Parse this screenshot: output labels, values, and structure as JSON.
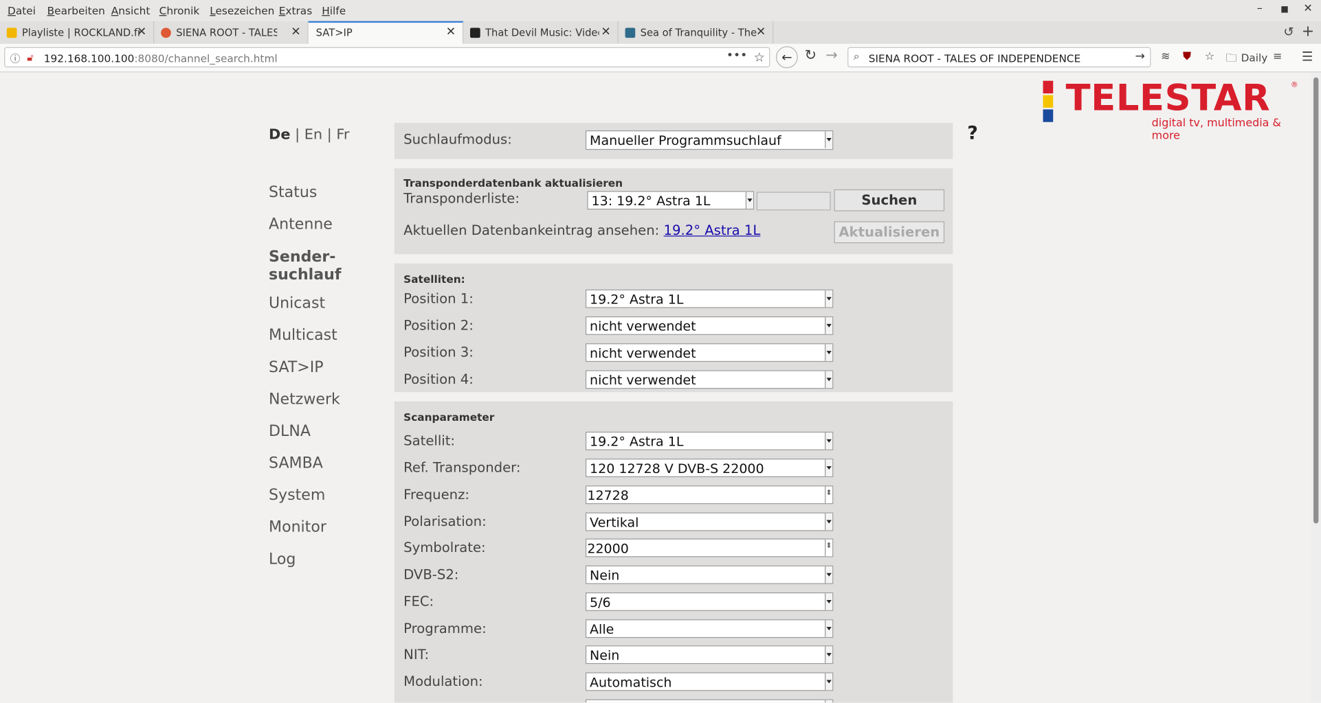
{
  "menubar": {
    "items": [
      "Datei",
      "Bearbeiten",
      "Ansicht",
      "Chronik",
      "Lesezeichen",
      "Extras",
      "Hilfe"
    ]
  },
  "tabs": [
    {
      "title": "Playliste | ROCKLAND.fm",
      "favicon_color": "#f2b705"
    },
    {
      "title": "SIENA ROOT - TALES OF",
      "favicon_color": "#de5833"
    },
    {
      "title": "SAT>IP",
      "favicon_color": ""
    },
    {
      "title": "That Devil Music: Video of",
      "favicon_color": "#222222"
    },
    {
      "title": "Sea of Tranquility - The W",
      "favicon_color": "#2f6b8a"
    }
  ],
  "address": {
    "host": "192.168.100.100",
    "rest": ":8080/channel_search.html"
  },
  "search": {
    "query": "SIENA ROOT - TALES OF INDEPENDENCE"
  },
  "toolbar": {
    "bookmark_folder": "Daily"
  },
  "brand": {
    "name": "TELESTAR",
    "reg": "®",
    "tagline": "digital tv, multimedia & more",
    "colors": {
      "red": "#d81e2c",
      "yellow": "#f5c400",
      "blue": "#1a4a9c"
    }
  },
  "languages": {
    "current": "De",
    "others": [
      "En",
      "Fr"
    ],
    "sep": "|"
  },
  "nav": [
    {
      "label": "Status"
    },
    {
      "label": "Antenne"
    },
    {
      "label": "Sender-\nsuchlauf",
      "active": true
    },
    {
      "label": "Unicast"
    },
    {
      "label": "Multicast"
    },
    {
      "label": "SAT>IP"
    },
    {
      "label": "Netzwerk"
    },
    {
      "label": "DLNA"
    },
    {
      "label": "SAMBA"
    },
    {
      "label": "System"
    },
    {
      "label": "Monitor"
    },
    {
      "label": "Log"
    }
  ],
  "help": "?",
  "mode": {
    "label": "Suchlaufmodus:",
    "value": "Manueller Programmsuchlauf"
  },
  "transponder_db": {
    "heading": "Transponderdatenbank aktualisieren",
    "list_label": "Transponderliste:",
    "list_value": "13: 19.2° Astra 1L",
    "search_button": "Suchen",
    "entry_label": "Aktuellen Datenbankeintrag ansehen:",
    "entry_link": "19.2° Astra 1L",
    "update_button": "Aktualisieren"
  },
  "satellites": {
    "heading": "Satelliten:",
    "rows": [
      {
        "label": "Position 1:",
        "value": "19.2° Astra 1L"
      },
      {
        "label": "Position 2:",
        "value": "nicht verwendet"
      },
      {
        "label": "Position 3:",
        "value": "nicht verwendet"
      },
      {
        "label": "Position 4:",
        "value": "nicht verwendet"
      }
    ]
  },
  "scan": {
    "heading": "Scanparameter",
    "rows": [
      {
        "label": "Satellit:",
        "value": "19.2° Astra 1L",
        "kind": "select"
      },
      {
        "label": "Ref. Transponder:",
        "value": "120 12728 V DVB-S 22000",
        "kind": "select"
      },
      {
        "label": "Frequenz:",
        "value": "12728",
        "kind": "spin"
      },
      {
        "label": "Polarisation:",
        "value": "Vertikal",
        "kind": "select"
      },
      {
        "label": "Symbolrate:",
        "value": "22000",
        "kind": "spin"
      },
      {
        "label": "DVB-S2:",
        "value": "Nein",
        "kind": "select"
      },
      {
        "label": "FEC:",
        "value": "5/6",
        "kind": "select"
      },
      {
        "label": "Programme:",
        "value": "Alle",
        "kind": "select"
      },
      {
        "label": "NIT:",
        "value": "Nein",
        "kind": "select"
      },
      {
        "label": "Modulation:",
        "value": "Automatisch",
        "kind": "select"
      }
    ]
  }
}
